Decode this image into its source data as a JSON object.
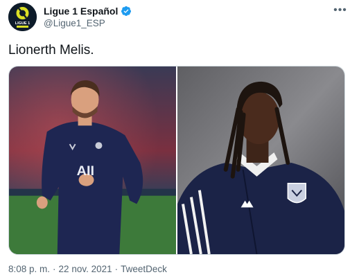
{
  "account": {
    "display_name": "Ligue 1 Español",
    "handle": "@Ligue1_ESP",
    "avatar_text": "LIGUE 1",
    "verified": true
  },
  "tweet": {
    "text": "Lionerth Melis.",
    "time": "8:08 p. m.",
    "separator": "·",
    "date": "22 nov. 2021",
    "source": "TweetDeck"
  },
  "media": {
    "photos": [
      {
        "subject": "player-in-navy-training-top",
        "shirt_text": "AII"
      },
      {
        "subject": "player-with-dreadlocks-navy-jacket"
      }
    ]
  },
  "icons": {
    "more": "more-icon",
    "verified": "verified-badge-icon"
  },
  "colors": {
    "text": "#0f1419",
    "secondary": "#536471",
    "verified": "#1d9bf0",
    "ligue1_green": "#dae025",
    "navy": "#1b2347"
  }
}
